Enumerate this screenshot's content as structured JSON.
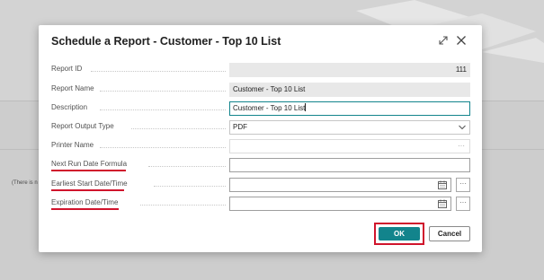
{
  "dialog": {
    "title": "Schedule a Report - Customer - Top 10 List",
    "expand_icon": "expand-icon",
    "close_icon": "close-icon"
  },
  "background": {
    "note": "(There is n"
  },
  "fields": {
    "report_id": {
      "label": "Report ID",
      "value": "111"
    },
    "report_name": {
      "label": "Report Name",
      "value": "Customer - Top 10 List"
    },
    "description": {
      "label": "Description",
      "value": "Customer - Top 10 List"
    },
    "report_output_type": {
      "label": "Report Output Type",
      "value": "PDF"
    },
    "printer_name": {
      "label": "Printer Name",
      "value": "",
      "button": "···"
    },
    "next_run_date_formula": {
      "label": "Next Run Date Formula",
      "value": ""
    },
    "earliest_start": {
      "label": "Earliest Start Date/Time",
      "value": "",
      "button": "···"
    },
    "expiration": {
      "label": "Expiration Date/Time",
      "value": "",
      "button": "···"
    }
  },
  "buttons": {
    "ok": "OK",
    "cancel": "Cancel"
  },
  "colors": {
    "accent": "#12848c",
    "highlight": "#d0142c"
  }
}
